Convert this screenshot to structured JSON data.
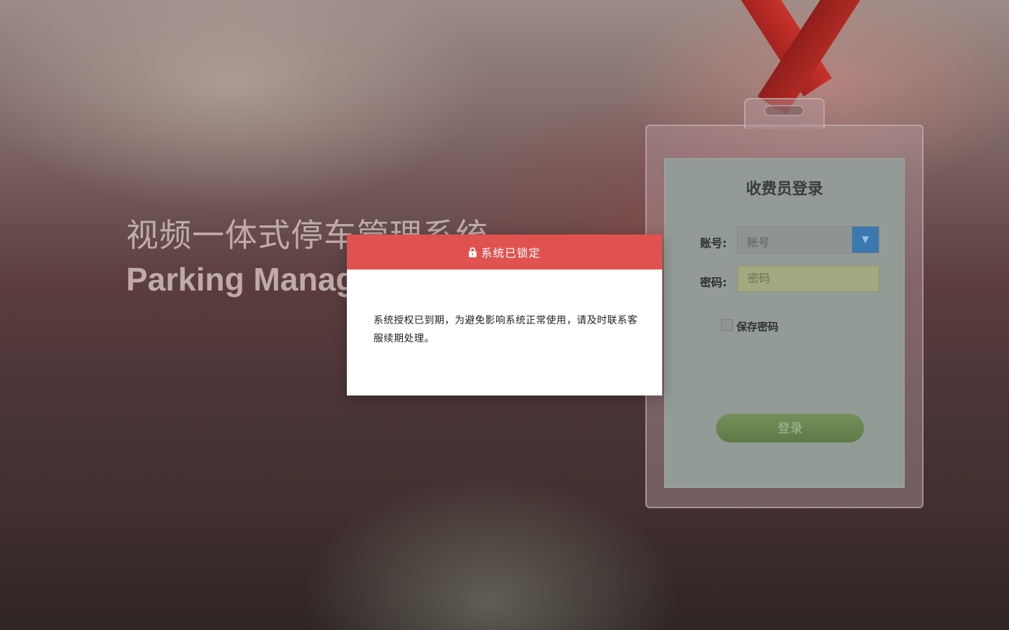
{
  "background": {
    "headline_cn": "视频一体式停车管理系统",
    "headline_en": "Parking Management System"
  },
  "login_card": {
    "title": "收费员登录",
    "account_label": "账号:",
    "account_placeholder": "账号",
    "password_label": "密码:",
    "password_placeholder": "密码",
    "remember_label": "保存密码",
    "remember_checked": false,
    "login_button": "登录",
    "dropdown_icon": "▼"
  },
  "modal": {
    "title": "系统已锁定",
    "icon": "lock-icon",
    "message": "系统授权已到期，为避免影响系统正常使用，请及时联系客服续期处理。",
    "header_color": "#e0524f"
  }
}
